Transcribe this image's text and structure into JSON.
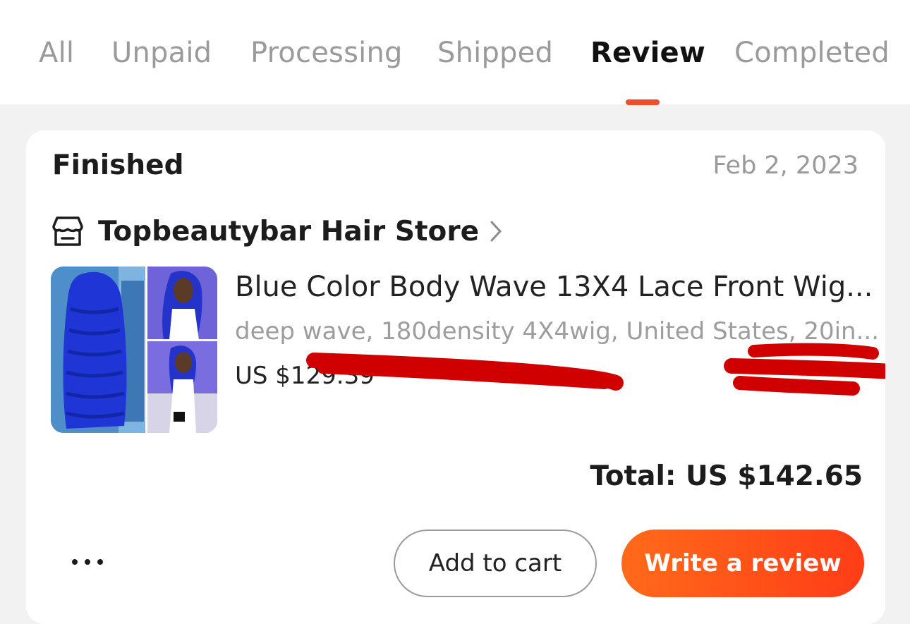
{
  "tabs": [
    {
      "label": "All",
      "active": false
    },
    {
      "label": "Unpaid",
      "active": false
    },
    {
      "label": "Processing",
      "active": false
    },
    {
      "label": "Shipped",
      "active": false
    },
    {
      "label": "Review",
      "active": true
    },
    {
      "label": "Completed",
      "active": false
    }
  ],
  "order": {
    "status": "Finished",
    "date": "Feb 2, 2023",
    "store": {
      "name": "Topbeautybar Hair Store",
      "icon": "store-icon"
    },
    "product": {
      "title": "Blue Color Body Wave 13X4 Lace Front Wig...",
      "variant": "deep wave, 180density 4X4wig, United States, 20in...",
      "price": "US $129.39"
    },
    "total": "Total: US $142.65",
    "actions": {
      "more_icon": "more-dots-icon",
      "add_to_cart": "Add to cart",
      "write_review": "Write a review"
    }
  },
  "colors": {
    "accent": "#f04d2b",
    "primary_button": "#ff5319",
    "redaction": "#d00000",
    "thumb_hair": "#1f35d6",
    "thumb_bg": "#6e63d8"
  }
}
